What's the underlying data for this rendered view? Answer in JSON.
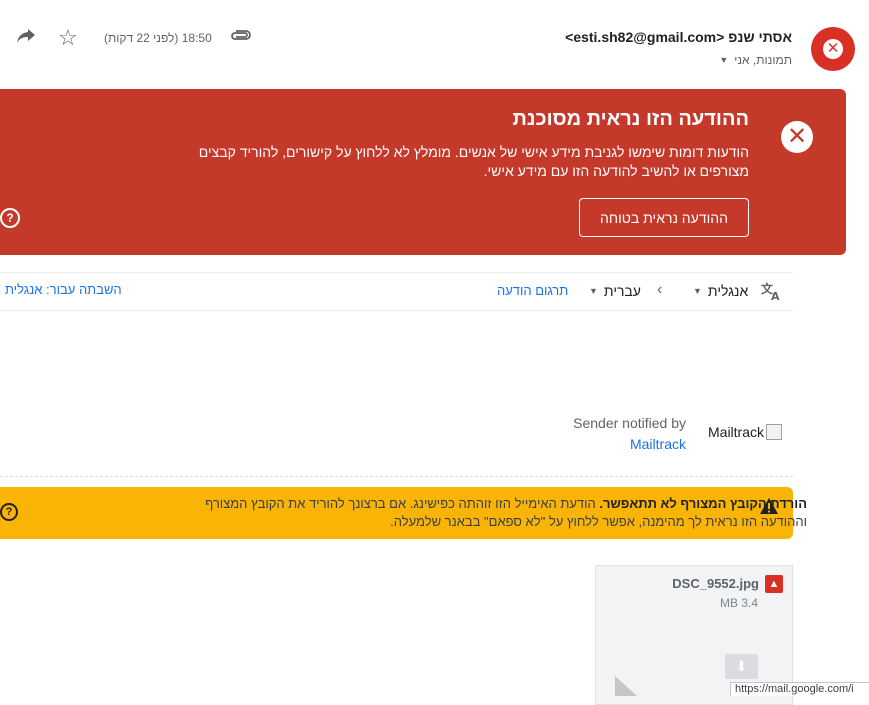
{
  "header": {
    "sender": "אסתי שנפ <esti.sh82@gmail.com>",
    "recipients": "תמונות, אני",
    "time": "18:50 (לפני 22 דקות)"
  },
  "danger_banner": {
    "title": "ההודעה הזו נראית מסוכנת",
    "body": "הודעות דומות שימשו לגניבת מידע אישי של אנשים. מומלץ לא ללחוץ על קישורים, להוריד קבצים מצורפים או להשיב להודעה הזו עם מידע אישי.",
    "safe_button": "ההודעה נראית בטוחה",
    "color": "#c5392b"
  },
  "translate": {
    "source_lang": "אנגלית",
    "target_lang": "עברית",
    "translate_link": "תרגום הודעה",
    "disable_link": "השבתה עבור: אנגלית"
  },
  "mailtrack": {
    "image_alt": "Mailtrack",
    "notified_text": "Sender notified by",
    "link": "Mailtrack"
  },
  "warning": {
    "strong": "הורדת הקובץ המצורף לא תתאפשר.",
    "text": " הודעת האימייל הזו זוהתה כפישינג. אם ברצונך להוריד את הקובץ המצורף וההודעה הזו נראית לך מהימנה, אפשר ללחוץ על \"לא ספאם\" בבאנר שלמעלה.",
    "color": "#f9b405"
  },
  "attachment": {
    "name": "DSC_9552.jpg",
    "size": "3.4 MB"
  },
  "status_url": "https://mail.google.com/i",
  "icons": {
    "avatar": "close-circle-icon",
    "clip": "paperclip-icon",
    "star": "star-icon",
    "forward": "forward-icon",
    "danger": "close-circle-icon",
    "help": "help-circle-icon",
    "translate": "translate-icon",
    "warning": "warning-triangle-icon",
    "image": "image-icon",
    "download": "download-icon"
  }
}
